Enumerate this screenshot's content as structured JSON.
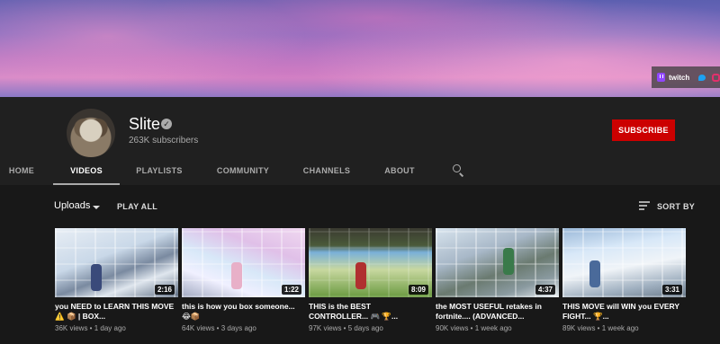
{
  "banner": {
    "links": [
      {
        "label": "twitch",
        "icon": "twitch-icon"
      },
      {
        "label": "",
        "icon": "twitter-icon"
      },
      {
        "label": "",
        "icon": "instagram-icon"
      }
    ]
  },
  "channel": {
    "name": "Slite",
    "subscribers": "263K subscribers",
    "subscribe_label": "SUBSCRIBE",
    "verified_glyph": "✓"
  },
  "tabs": [
    {
      "label": "HOME",
      "active": false
    },
    {
      "label": "VIDEOS",
      "active": true
    },
    {
      "label": "PLAYLISTS",
      "active": false
    },
    {
      "label": "COMMUNITY",
      "active": false
    },
    {
      "label": "CHANNELS",
      "active": false
    },
    {
      "label": "ABOUT",
      "active": false
    }
  ],
  "toolbar": {
    "uploads_label": "Uploads",
    "play_all_label": "PLAY ALL",
    "sort_label": "SORT BY"
  },
  "videos": [
    {
      "title": "you NEED to LEARN THIS MOVE ⚠️ 📦 | BOX...",
      "duration": "2:16",
      "meta": "36K views • 1 day ago"
    },
    {
      "title": "this is how you box someone... 😂📦",
      "duration": "1:22",
      "meta": "64K views • 3 days ago"
    },
    {
      "title": "THIS is the BEST CONTROLLER... 🎮 🏆...",
      "duration": "8:09",
      "meta": "97K views • 5 days ago"
    },
    {
      "title": "the MOST USEFUL retakes in fortnite.... (ADVANCED...",
      "duration": "4:37",
      "meta": "90K views • 1 week ago"
    },
    {
      "title": "THIS MOVE will WIN you EVERY FIGHT... 🏆...",
      "duration": "3:31",
      "meta": "89K views • 1 week ago"
    }
  ],
  "colors": {
    "subscribe": "#cc0000",
    "background": "#181818",
    "header": "#202020"
  }
}
